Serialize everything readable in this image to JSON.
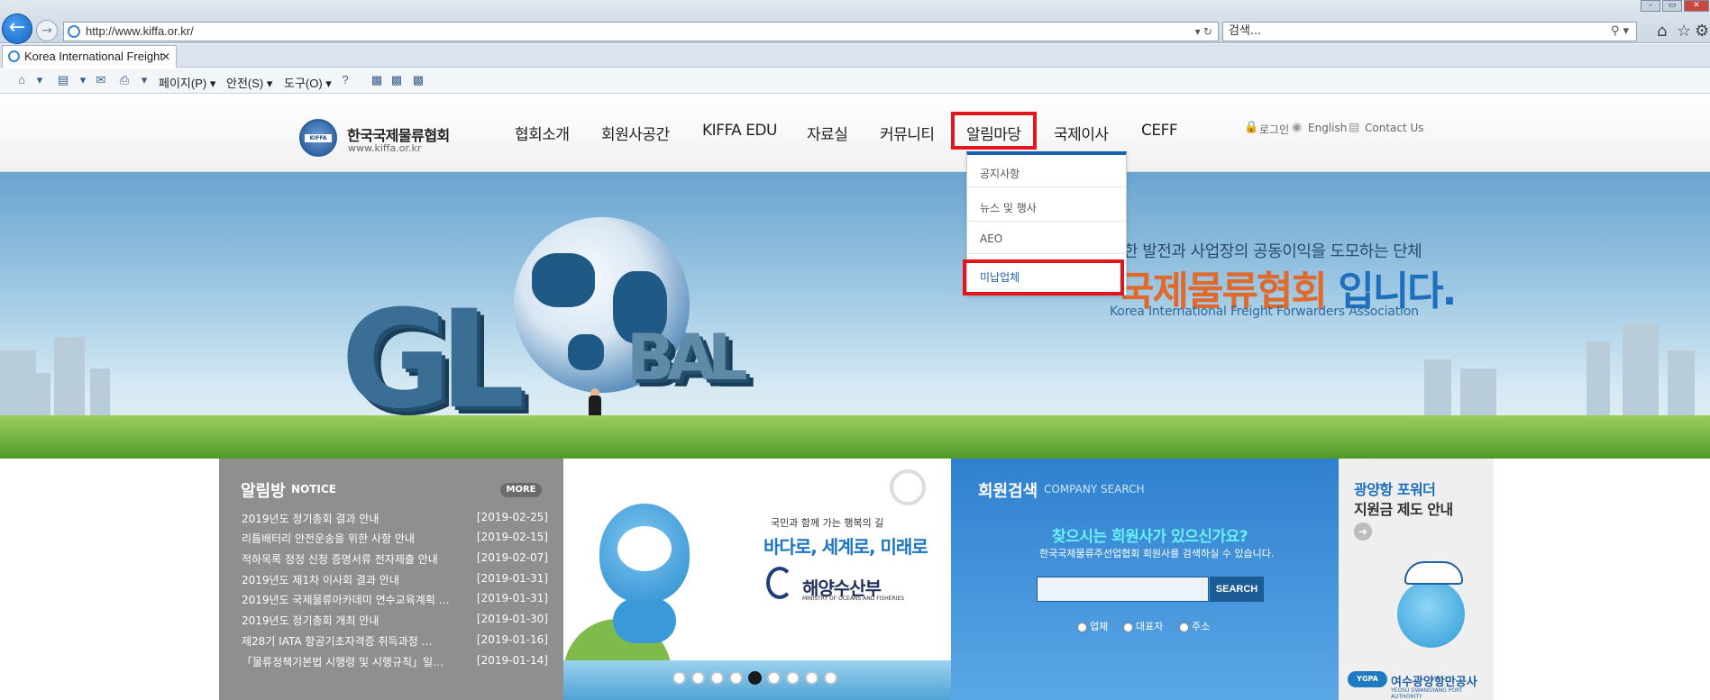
{
  "browser": {
    "address": "http://www.kiffa.or.kr/",
    "search_placeholder": "검색...",
    "tab_title": "Korea International Freight ...",
    "tab_close": "✕",
    "commands": {
      "page": "페이지(P) ▾",
      "safety": "안전(S) ▾",
      "tools": "도구(O) ▾"
    }
  },
  "header": {
    "logo_name": "한국국제물류협회",
    "logo_url": "www.kiffa.or.kr",
    "logo_badge": "KIFFA",
    "nav": [
      "협회소개",
      "회원사공간",
      "KIFFA EDU",
      "자료실",
      "커뮤니티",
      "알림마당",
      "국제이사",
      "CEFF"
    ],
    "util": {
      "login": "로그인",
      "english": "English",
      "contact": "Contact Us"
    }
  },
  "dropdown": {
    "items": [
      "공지사항",
      "뉴스 및 행사",
      "AEO",
      "미납업체"
    ]
  },
  "hero": {
    "line1": "한 발전과 사업장의 공동이익을 도모하는 단체",
    "line2_orange": "국제물류협회",
    "line2_blue": " 입니다.",
    "line3": "Korea International Freight Forwarders Association",
    "letters": {
      "g": "G",
      "l": "L",
      "b": "B",
      "a": "A",
      "l2": "L"
    }
  },
  "notice": {
    "title": "알림방",
    "subtitle": "NOTICE",
    "more": "MORE",
    "rows": [
      {
        "title": "2019년도 정기총회 결과 안내",
        "date": "[2019-02-25]"
      },
      {
        "title": "리튬배터리 안전운송을 위한 사항 안내",
        "date": "[2019-02-15]"
      },
      {
        "title": "적하목록 정정 신청 증명서류 전자제출 안내",
        "date": "[2019-02-07]"
      },
      {
        "title": "2019년도 제1차 이사회 결과 안내",
        "date": "[2019-01-31]"
      },
      {
        "title": "2019년도 국제물류아카데미 연수교육계획 …",
        "date": "[2019-01-31]"
      },
      {
        "title": "2019년도 정기총회 개최 안내",
        "date": "[2019-01-30]"
      },
      {
        "title": "제28기 IATA 항공기초자격증 취득과정 …",
        "date": "[2019-01-16]"
      },
      {
        "title": "「물류정책기본법 시행령 및 시행규칙」일부개…",
        "date": "[2019-01-14]"
      }
    ]
  },
  "campaign": {
    "small": "국민과 함께 가는 행복의 길",
    "big": "바다로, 세계로, 미래로",
    "ministry": "해양수산부",
    "ministry_en": "MINISTRY OF OCEANS AND FISHERIES",
    "active_dot": 5,
    "dot_count": 9
  },
  "member": {
    "title": "회원검색",
    "subtitle": "COMPANY SEARCH",
    "question": "찾으시는 회원사가 있으신가요?",
    "desc": "한국국제물류주선업협회 회원사를 검색하실 수 있습니다.",
    "search_button": "SEARCH",
    "radios": [
      "업체",
      "대표자",
      "주소"
    ]
  },
  "gwangyang": {
    "line1": "광양항 포워더",
    "line2": "지원금 제도 안내",
    "badge": "YGPA",
    "logo": "여수광양항만공사",
    "logo_en": "YEOSU GWANGYANG PORT AUTHORITY"
  },
  "colors": {
    "highlight": "#e3161e",
    "primary_blue": "#1a5fb0",
    "accent_orange": "#e06a2c"
  }
}
